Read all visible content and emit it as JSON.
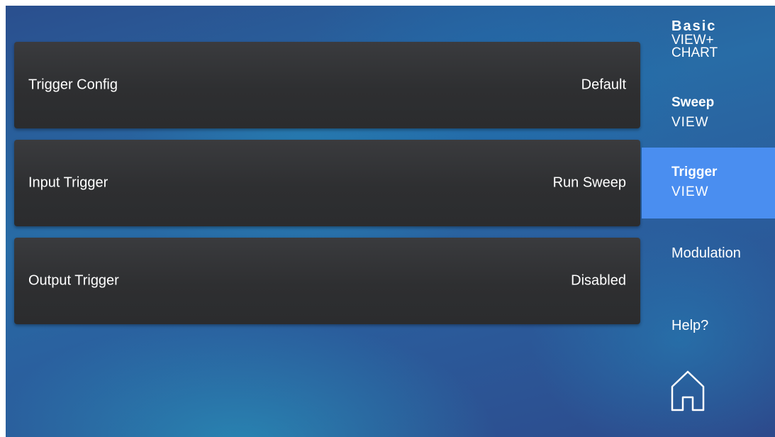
{
  "rows": [
    {
      "label": "Trigger Config",
      "value": "Default"
    },
    {
      "label": "Input Trigger",
      "value": "Run Sweep"
    },
    {
      "label": "Output Trigger",
      "value": "Disabled"
    }
  ],
  "nav": {
    "basic": {
      "title": "Basic",
      "line1": "VIEW+",
      "line2": "CHART"
    },
    "sweep": {
      "title": "Sweep",
      "subtitle": "VIEW"
    },
    "trigger": {
      "title": "Trigger",
      "subtitle": "VIEW",
      "active": true
    },
    "modulation": {
      "label": "Modulation"
    },
    "help": {
      "label": "Help?"
    },
    "home_icon": "home-icon"
  },
  "colors": {
    "active_nav": "#4a8ef0",
    "row_background": "#2e2f31",
    "text": "#ffffff"
  }
}
